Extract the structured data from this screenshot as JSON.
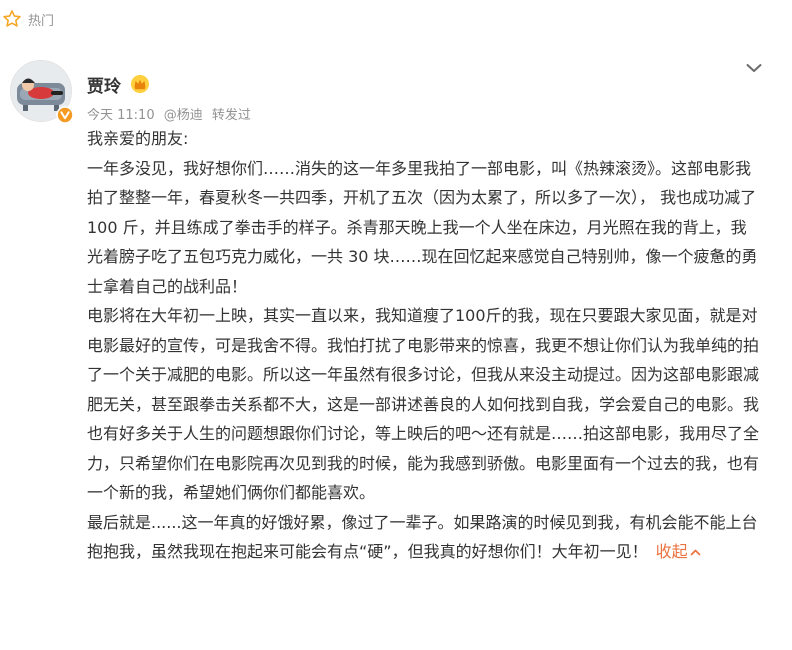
{
  "hot": {
    "label": "热门",
    "icon": "star-outline-icon",
    "icon_color": "#f5a623"
  },
  "post": {
    "author": "贾玲",
    "author_badge_icon": "crown-icon",
    "verified_icon": "verified-badge-icon",
    "meta_time": "今天 11:10",
    "meta_via": "@杨迪",
    "meta_action": "转发过",
    "more_icon": "chevron-down-icon",
    "paragraphs": [
      "我亲爱的朋友:",
      "一年多没见，我好想你们……消失的这一年多里我拍了一部电影，叫《热辣滚烫》。这部电影我拍了整整一年，春夏秋冬一共四季，开机了五次（因为太累了，所以多了一次）， 我也成功减了 100 斤，并且练成了拳击手的样子。杀青那天晚上我一个人坐在床边，月光照在我的背上，我光着膀子吃了五包巧克力威化，一共 30 块……现在回忆起来感觉自己特别帅，像一个疲惫的勇士拿着自己的战利品！",
      "电影将在大年初一上映，其实一直以来，我知道瘦了100斤的我，现在只要跟大家见面，就是对电影最好的宣传，可是我舍不得。我怕打扰了电影带来的惊喜，我更不想让你们认为我单纯的拍了一个关于减肥的电影。所以这一年虽然有很多讨论，但我从来没主动提过。因为这部电影跟减肥无关，甚至跟拳击关系都不大，这是一部讲述善良的人如何找到自我，学会爱自己的电影。我也有好多关于人生的问题想跟你们讨论，等上映后的吧～还有就是……拍这部电影，我用尽了全力，只希望你们在电影院再次见到我的时候，能为我感到骄傲。电影里面有一个过去的我，也有一个新的我，希望她们俩你们都能喜欢。",
      "最后就是......这一年真的好饿好累，像过了一辈子。如果路演的时候见到我，有机会能不能上台抱抱我，虽然我现在抱起来可能会有点“硬”，但我真的好想你们！大年初一见！"
    ],
    "collapse_label": "收起",
    "collapse_icon": "chevron-up-icon",
    "link_color": "#eb7340"
  }
}
